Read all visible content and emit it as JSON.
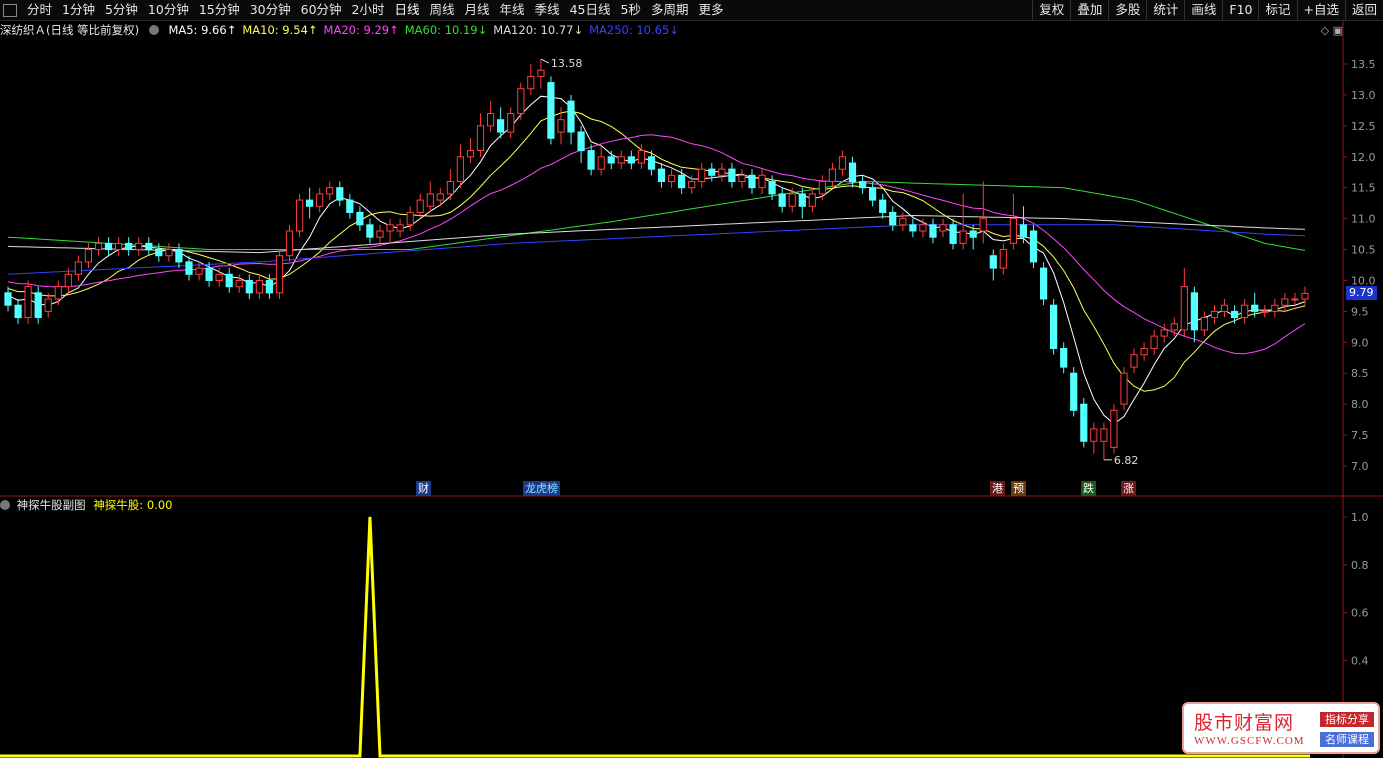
{
  "toolbar": {
    "periods": [
      "分时",
      "1分钟",
      "5分钟",
      "10分钟",
      "15分钟",
      "30分钟",
      "60分钟",
      "2小时",
      "日线",
      "周线",
      "月线",
      "年线",
      "季线",
      "45日线",
      "5秒",
      "多周期",
      "更多"
    ],
    "active_period": "日线",
    "right_items": [
      "复权",
      "叠加",
      "多股",
      "统计",
      "画线",
      "F10",
      "标记",
      "+自选",
      "返回"
    ]
  },
  "main_info": {
    "title": "深纺织Ａ(日线 等比前复权)",
    "indicators": [
      {
        "label": "MA5: 9.66↑",
        "color": "#ffffff"
      },
      {
        "label": "MA10: 9.54↑",
        "color": "#ffff55"
      },
      {
        "label": "MA20: 9.29↑",
        "color": "#ff44ff"
      },
      {
        "label": "MA60: 10.19↓",
        "color": "#33dd33"
      },
      {
        "label": "MA120: 10.77↓",
        "color": "#dddddd"
      },
      {
        "label": "MA250: 10.65↓",
        "color": "#3344ff"
      }
    ],
    "high_label": "13.58",
    "low_label": "6.82",
    "last_price": "9.79",
    "y_ticks": [
      "13.5",
      "13.0",
      "12.5",
      "12.0",
      "11.5",
      "11.0",
      "10.5",
      "10.0",
      "9.5",
      "9.0",
      "8.5",
      "8.0",
      "7.5",
      "7.0"
    ]
  },
  "events": [
    {
      "label": "财",
      "bg": "#1d3a8a",
      "color": "#ffffff"
    },
    {
      "label": "龙虎榜",
      "bg": "#1d3a8a",
      "color": "#7fe8ff"
    },
    {
      "label": "港",
      "bg": "#6b1a1a",
      "color": "#ffffff"
    },
    {
      "label": "预",
      "bg": "#6b3a10",
      "color": "#ffffff"
    },
    {
      "label": "跌",
      "bg": "#1a5a1a",
      "color": "#ffffff"
    },
    {
      "label": "涨",
      "bg": "#6b1a1a",
      "color": "#ffffff"
    }
  ],
  "sub_info": {
    "title": "神探牛股副图",
    "indicator": "神探牛股: 0.00",
    "y_ticks": [
      "1.0",
      "0.8",
      "0.6",
      "0.4"
    ]
  },
  "watermark": {
    "title": "股市财富网",
    "url": "WWW.GSCFW.COM",
    "tag1": "指标分享",
    "tag2": "名师课程"
  },
  "colors": {
    "up": "#ff3c3c",
    "down": "#54ffff",
    "ma5": "#ffffff",
    "ma10": "#ffff55",
    "ma20": "#ff44ff",
    "ma60": "#33dd33",
    "ma120": "#dddddd",
    "ma250": "#3344ff",
    "sub": "#ffff00"
  },
  "chart_data": {
    "type": "candlestick",
    "ylim": [
      6.7,
      13.7
    ],
    "candles": [
      [
        9.8,
        9.6,
        9.9,
        9.5
      ],
      [
        9.6,
        9.4,
        9.7,
        9.3
      ],
      [
        9.4,
        9.9,
        10.0,
        9.3
      ],
      [
        9.8,
        9.4,
        9.9,
        9.3
      ],
      [
        9.5,
        9.7,
        9.8,
        9.4
      ],
      [
        9.7,
        9.9,
        10.0,
        9.6
      ],
      [
        9.9,
        10.1,
        10.2,
        9.8
      ],
      [
        10.1,
        10.3,
        10.4,
        10.0
      ],
      [
        10.3,
        10.5,
        10.6,
        10.2
      ],
      [
        10.5,
        10.6,
        10.7,
        10.4
      ],
      [
        10.6,
        10.5,
        10.7,
        10.4
      ],
      [
        10.5,
        10.6,
        10.7,
        10.4
      ],
      [
        10.6,
        10.5,
        10.7,
        10.4
      ],
      [
        10.5,
        10.6,
        10.7,
        10.4
      ],
      [
        10.6,
        10.5,
        10.7,
        10.4
      ],
      [
        10.5,
        10.4,
        10.6,
        10.3
      ],
      [
        10.4,
        10.5,
        10.6,
        10.3
      ],
      [
        10.5,
        10.3,
        10.6,
        10.2
      ],
      [
        10.3,
        10.1,
        10.4,
        10.0
      ],
      [
        10.1,
        10.2,
        10.3,
        10.0
      ],
      [
        10.2,
        10.0,
        10.3,
        9.9
      ],
      [
        10.0,
        10.1,
        10.2,
        9.9
      ],
      [
        10.1,
        9.9,
        10.2,
        9.8
      ],
      [
        9.9,
        10.0,
        10.1,
        9.8
      ],
      [
        10.0,
        9.8,
        10.1,
        9.7
      ],
      [
        9.8,
        10.0,
        10.1,
        9.7
      ],
      [
        10.0,
        9.8,
        10.1,
        9.7
      ],
      [
        9.8,
        10.4,
        10.5,
        9.7
      ],
      [
        10.4,
        10.8,
        10.9,
        10.3
      ],
      [
        10.8,
        11.3,
        11.4,
        10.7
      ],
      [
        11.3,
        11.2,
        11.5,
        11.0
      ],
      [
        11.2,
        11.4,
        11.5,
        11.1
      ],
      [
        11.4,
        11.5,
        11.6,
        11.3
      ],
      [
        11.5,
        11.3,
        11.6,
        11.2
      ],
      [
        11.3,
        11.1,
        11.4,
        11.0
      ],
      [
        11.1,
        10.9,
        11.2,
        10.8
      ],
      [
        10.9,
        10.7,
        11.0,
        10.6
      ],
      [
        10.7,
        10.8,
        10.9,
        10.6
      ],
      [
        10.8,
        10.9,
        11.0,
        10.6
      ],
      [
        10.8,
        10.9,
        11.0,
        10.7
      ],
      [
        10.9,
        11.1,
        11.2,
        10.8
      ],
      [
        11.1,
        11.3,
        11.4,
        11.0
      ],
      [
        11.2,
        11.4,
        11.6,
        11.1
      ],
      [
        11.3,
        11.4,
        11.5,
        11.2
      ],
      [
        11.4,
        11.6,
        11.8,
        11.3
      ],
      [
        11.6,
        12.0,
        12.2,
        11.5
      ],
      [
        12.0,
        12.1,
        12.3,
        11.9
      ],
      [
        12.1,
        12.5,
        12.7,
        12.0
      ],
      [
        12.5,
        12.7,
        12.9,
        12.4
      ],
      [
        12.6,
        12.4,
        12.8,
        12.3
      ],
      [
        12.4,
        12.7,
        12.8,
        12.3
      ],
      [
        12.7,
        13.1,
        13.2,
        12.6
      ],
      [
        13.1,
        13.3,
        13.5,
        13.0
      ],
      [
        13.3,
        13.4,
        13.58,
        13.1
      ],
      [
        13.2,
        12.3,
        13.3,
        12.2
      ],
      [
        12.4,
        12.6,
        12.8,
        12.2
      ],
      [
        12.9,
        12.4,
        13.0,
        12.2
      ],
      [
        12.4,
        12.1,
        12.5,
        11.9
      ],
      [
        12.1,
        11.8,
        12.2,
        11.7
      ],
      [
        11.8,
        12.0,
        12.2,
        11.7
      ],
      [
        12.0,
        11.9,
        12.1,
        11.8
      ],
      [
        11.9,
        12.0,
        12.1,
        11.8
      ],
      [
        12.0,
        11.9,
        12.1,
        11.8
      ],
      [
        11.9,
        12.1,
        12.2,
        11.8
      ],
      [
        12.0,
        11.8,
        12.1,
        11.7
      ],
      [
        11.8,
        11.6,
        11.9,
        11.5
      ],
      [
        11.6,
        11.7,
        11.8,
        11.5
      ],
      [
        11.7,
        11.5,
        11.8,
        11.4
      ],
      [
        11.5,
        11.6,
        11.7,
        11.4
      ],
      [
        11.6,
        11.8,
        11.9,
        11.5
      ],
      [
        11.8,
        11.7,
        11.9,
        11.6
      ],
      [
        11.7,
        11.8,
        11.9,
        11.6
      ],
      [
        11.8,
        11.6,
        11.9,
        11.5
      ],
      [
        11.6,
        11.7,
        11.8,
        11.5
      ],
      [
        11.7,
        11.5,
        11.8,
        11.4
      ],
      [
        11.5,
        11.7,
        11.8,
        11.4
      ],
      [
        11.6,
        11.4,
        11.7,
        11.3
      ],
      [
        11.4,
        11.2,
        11.5,
        11.1
      ],
      [
        11.2,
        11.4,
        11.5,
        11.1
      ],
      [
        11.4,
        11.2,
        11.5,
        11.0
      ],
      [
        11.2,
        11.4,
        11.5,
        11.1
      ],
      [
        11.4,
        11.6,
        11.7,
        11.3
      ],
      [
        11.6,
        11.8,
        11.9,
        11.5
      ],
      [
        11.8,
        12.0,
        12.1,
        11.7
      ],
      [
        11.9,
        11.6,
        12.0,
        11.5
      ],
      [
        11.6,
        11.5,
        11.7,
        11.4
      ],
      [
        11.5,
        11.3,
        11.6,
        11.2
      ],
      [
        11.3,
        11.1,
        11.4,
        11.0
      ],
      [
        11.1,
        10.9,
        11.2,
        10.8
      ],
      [
        10.9,
        11.0,
        11.1,
        10.8
      ],
      [
        10.9,
        10.8,
        11.0,
        10.7
      ],
      [
        10.8,
        10.9,
        11.0,
        10.7
      ],
      [
        10.9,
        10.7,
        11.0,
        10.6
      ],
      [
        10.8,
        10.9,
        11.0,
        10.7
      ],
      [
        10.9,
        10.6,
        11.0,
        10.5
      ],
      [
        10.6,
        10.8,
        11.4,
        10.5
      ],
      [
        10.8,
        10.7,
        10.9,
        10.5
      ],
      [
        10.8,
        11.0,
        11.6,
        10.6
      ],
      [
        10.4,
        10.2,
        10.5,
        10.0
      ],
      [
        10.2,
        10.5,
        10.6,
        10.1
      ],
      [
        10.6,
        11.0,
        11.4,
        10.5
      ],
      [
        10.9,
        10.7,
        11.2,
        10.6
      ],
      [
        10.8,
        10.3,
        10.9,
        10.2
      ],
      [
        10.2,
        9.7,
        10.3,
        9.6
      ],
      [
        9.6,
        8.9,
        9.7,
        8.8
      ],
      [
        8.9,
        8.6,
        9.0,
        8.5
      ],
      [
        8.5,
        7.9,
        8.6,
        7.8
      ],
      [
        8.0,
        7.4,
        8.1,
        7.3
      ],
      [
        7.4,
        7.6,
        7.7,
        7.2
      ],
      [
        7.4,
        7.6,
        7.7,
        7.1
      ],
      [
        7.3,
        7.9,
        8.0,
        7.2
      ],
      [
        8.0,
        8.5,
        8.6,
        7.9
      ],
      [
        8.6,
        8.8,
        8.9,
        8.5
      ],
      [
        8.8,
        8.9,
        9.0,
        8.7
      ],
      [
        8.9,
        9.1,
        9.2,
        8.8
      ],
      [
        9.1,
        9.2,
        9.3,
        9.0
      ],
      [
        9.2,
        9.3,
        9.4,
        9.1
      ],
      [
        9.2,
        9.9,
        10.2,
        9.1
      ],
      [
        9.8,
        9.2,
        9.9,
        9.0
      ],
      [
        9.2,
        9.4,
        9.5,
        9.1
      ],
      [
        9.4,
        9.5,
        9.6,
        9.3
      ],
      [
        9.5,
        9.6,
        9.7,
        9.4
      ],
      [
        9.5,
        9.4,
        9.6,
        9.3
      ],
      [
        9.4,
        9.6,
        9.7,
        9.3
      ],
      [
        9.6,
        9.5,
        9.8,
        9.4
      ],
      [
        9.5,
        9.5,
        9.6,
        9.4
      ],
      [
        9.5,
        9.6,
        9.7,
        9.4
      ],
      [
        9.6,
        9.7,
        9.8,
        9.5
      ],
      [
        9.7,
        9.7,
        9.8,
        9.6
      ],
      [
        9.7,
        9.79,
        9.9,
        9.6
      ]
    ],
    "sub_series": "spike to 1.0 near bar 36, otherwise 0.00"
  }
}
